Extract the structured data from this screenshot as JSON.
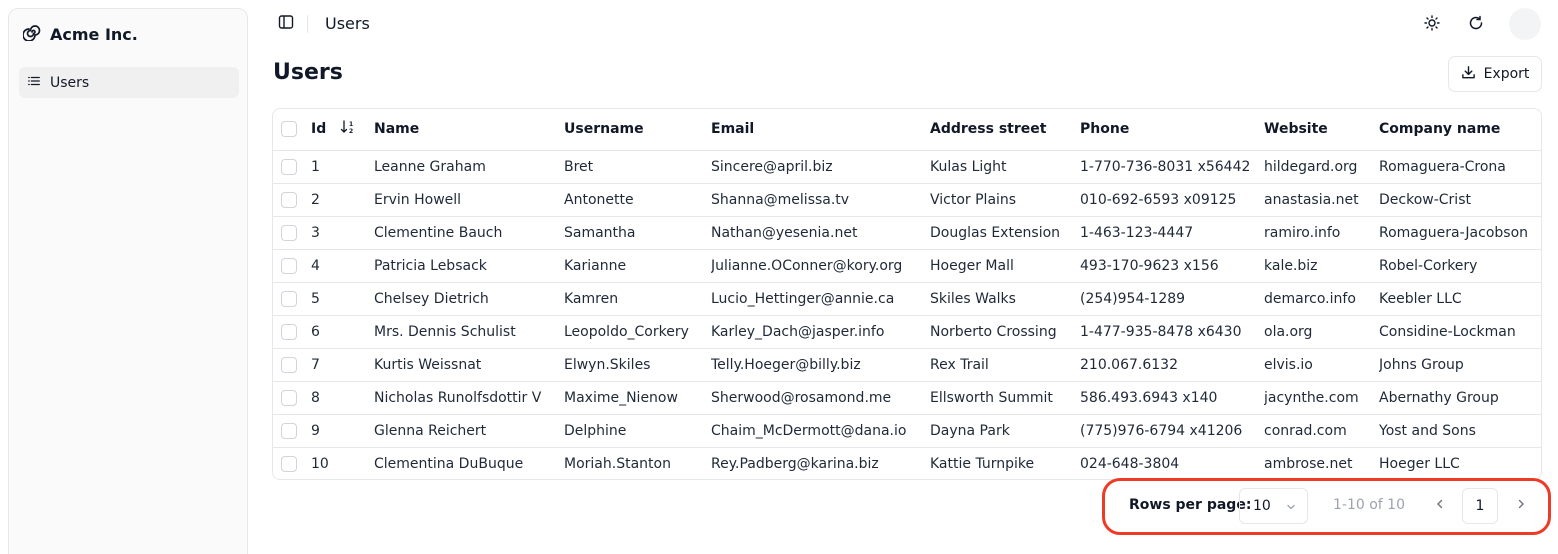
{
  "app": {
    "brand_name": "Acme Inc."
  },
  "sidebar": {
    "items": [
      {
        "label": "Users",
        "icon": "list-icon"
      }
    ]
  },
  "header": {
    "breadcrumb_current": "Users",
    "theme_icon": "sun-icon",
    "refresh_icon": "refresh-icon"
  },
  "page": {
    "title": "Users",
    "export_label": "Export"
  },
  "table": {
    "columns": [
      "Id",
      "Name",
      "Username",
      "Email",
      "Address street",
      "Phone",
      "Website",
      "Company name"
    ],
    "rows": [
      [
        "1",
        "Leanne Graham",
        "Bret",
        "Sincere@april.biz",
        "Kulas Light",
        "1-770-736-8031 x56442",
        "hildegard.org",
        "Romaguera-Crona"
      ],
      [
        "2",
        "Ervin Howell",
        "Antonette",
        "Shanna@melissa.tv",
        "Victor Plains",
        "010-692-6593 x09125",
        "anastasia.net",
        "Deckow-Crist"
      ],
      [
        "3",
        "Clementine Bauch",
        "Samantha",
        "Nathan@yesenia.net",
        "Douglas Extension",
        "1-463-123-4447",
        "ramiro.info",
        "Romaguera-Jacobson"
      ],
      [
        "4",
        "Patricia Lebsack",
        "Karianne",
        "Julianne.OConner@kory.org",
        "Hoeger Mall",
        "493-170-9623 x156",
        "kale.biz",
        "Robel-Corkery"
      ],
      [
        "5",
        "Chelsey Dietrich",
        "Kamren",
        "Lucio_Hettinger@annie.ca",
        "Skiles Walks",
        "(254)954-1289",
        "demarco.info",
        "Keebler LLC"
      ],
      [
        "6",
        "Mrs. Dennis Schulist",
        "Leopoldo_Corkery",
        "Karley_Dach@jasper.info",
        "Norberto Crossing",
        "1-477-935-8478 x6430",
        "ola.org",
        "Considine-Lockman"
      ],
      [
        "7",
        "Kurtis Weissnat",
        "Elwyn.Skiles",
        "Telly.Hoeger@billy.biz",
        "Rex Trail",
        "210.067.6132",
        "elvis.io",
        "Johns Group"
      ],
      [
        "8",
        "Nicholas Runolfsdottir V",
        "Maxime_Nienow",
        "Sherwood@rosamond.me",
        "Ellsworth Summit",
        "586.493.6943 x140",
        "jacynthe.com",
        "Abernathy Group"
      ],
      [
        "9",
        "Glenna Reichert",
        "Delphine",
        "Chaim_McDermott@dana.io",
        "Dayna Park",
        "(775)976-6794 x41206",
        "conrad.com",
        "Yost and Sons"
      ],
      [
        "10",
        "Clementina DuBuque",
        "Moriah.Stanton",
        "Rey.Padberg@karina.biz",
        "Kattie Turnpike",
        "024-648-3804",
        "ambrose.net",
        "Hoeger LLC"
      ]
    ]
  },
  "pagination": {
    "rows_per_page_label": "Rows per page:",
    "rows_per_page_value": "10",
    "range_label": "1-10 of 10",
    "current_page": "1"
  },
  "colors": {
    "highlight": "#ef3a25",
    "border": "#e5e7eb",
    "muted_text": "#9ca3af"
  }
}
